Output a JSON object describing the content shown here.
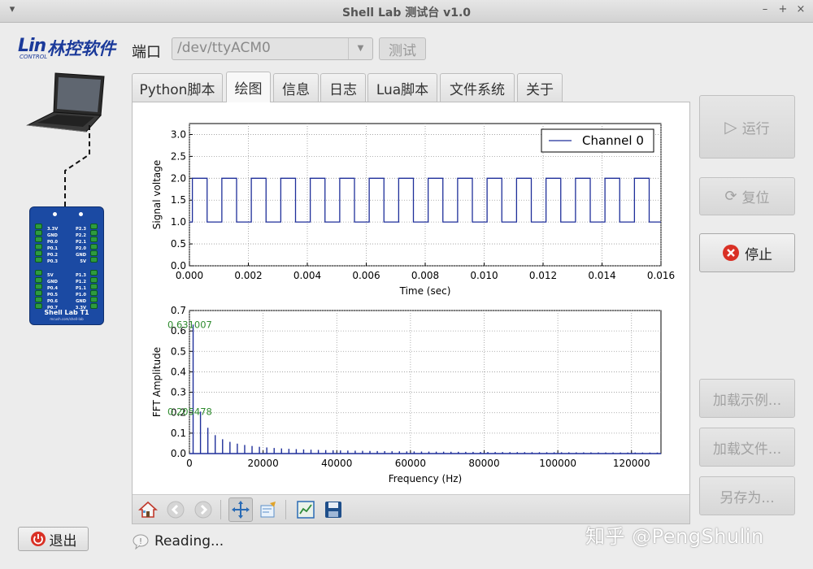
{
  "window": {
    "title": "Shell Lab 测试台 v1.0",
    "controls": [
      "–",
      "+",
      "×"
    ]
  },
  "logo": {
    "mark": "Lin",
    "brand": "林控软件",
    "sub": "CONTROL"
  },
  "board": {
    "name": "Shell Lab T1",
    "url": "mcush.com/shell-lab",
    "left_pins": [
      "3.3V",
      "GND",
      "P0.0",
      "P0.1",
      "P0.2",
      "P0.3",
      "",
      "5V",
      "GND",
      "P0.4",
      "P0.5",
      "P0.6",
      "P0.7"
    ],
    "right_pins": [
      "P2.3",
      "P2.2",
      "P2.1",
      "P2.0",
      "GND",
      "5V",
      "",
      "P1.3",
      "P1.2",
      "P1.1",
      "P1.0",
      "GND",
      "3.3V"
    ]
  },
  "port": {
    "label": "端口",
    "value": "/dev/ttyACM0",
    "test_label": "测试"
  },
  "tabs": [
    {
      "label": "Python脚本",
      "active": false
    },
    {
      "label": "绘图",
      "active": true
    },
    {
      "label": "信息",
      "active": false
    },
    {
      "label": "日志",
      "active": false
    },
    {
      "label": "Lua脚本",
      "active": false
    },
    {
      "label": "文件系统",
      "active": false
    },
    {
      "label": "关于",
      "active": false
    }
  ],
  "chart_data": [
    {
      "type": "line",
      "xlabel": "Time (sec)",
      "ylabel": "Signal voltage",
      "xlim": [
        0,
        0.016
      ],
      "ylim": [
        0,
        3.25
      ],
      "xticks": [
        "0.000",
        "0.002",
        "0.004",
        "0.006",
        "0.008",
        "0.010",
        "0.012",
        "0.014",
        "0.016"
      ],
      "yticks": [
        "0.0",
        "0.5",
        "1.0",
        "1.5",
        "2.0",
        "2.5",
        "3.0"
      ],
      "grid": true,
      "legend": "top-right",
      "series": [
        {
          "name": "Channel 0",
          "color": "#1f2f9a",
          "low": 1.0,
          "high": 2.0,
          "period": 0.001,
          "first_rise": 0.0001
        }
      ]
    },
    {
      "type": "line",
      "xlabel": "Frequency (Hz)",
      "ylabel": "FFT Amplitude",
      "xlim": [
        0,
        128000
      ],
      "ylim": [
        0,
        0.7
      ],
      "xticks": [
        "0",
        "20000",
        "40000",
        "60000",
        "80000",
        "100000",
        "120000"
      ],
      "yticks": [
        "0.0",
        "0.1",
        "0.2",
        "0.3",
        "0.4",
        "0.5",
        "0.6",
        "0.7"
      ],
      "grid": true,
      "fundamental_hz": 1000,
      "color": "#1f2f9a",
      "annotations": [
        {
          "text": "0.631007",
          "x": 1000,
          "y": 0.631007
        },
        {
          "text": "0.205478",
          "x": 3000,
          "y": 0.205478
        }
      ]
    }
  ],
  "toolbar": [
    "home-icon",
    "back-icon",
    "forward-icon",
    "pan-icon",
    "subplots-icon",
    "zoom-fit-icon",
    "save-icon"
  ],
  "right_buttons": {
    "run": "运行",
    "reset": "复位",
    "stop": "停止",
    "load_example": "加载示例...",
    "load_file": "加载文件...",
    "save_as": "另存为..."
  },
  "exit_label": "退出",
  "status": "Reading...",
  "watermark": "知乎 @PengShulin"
}
